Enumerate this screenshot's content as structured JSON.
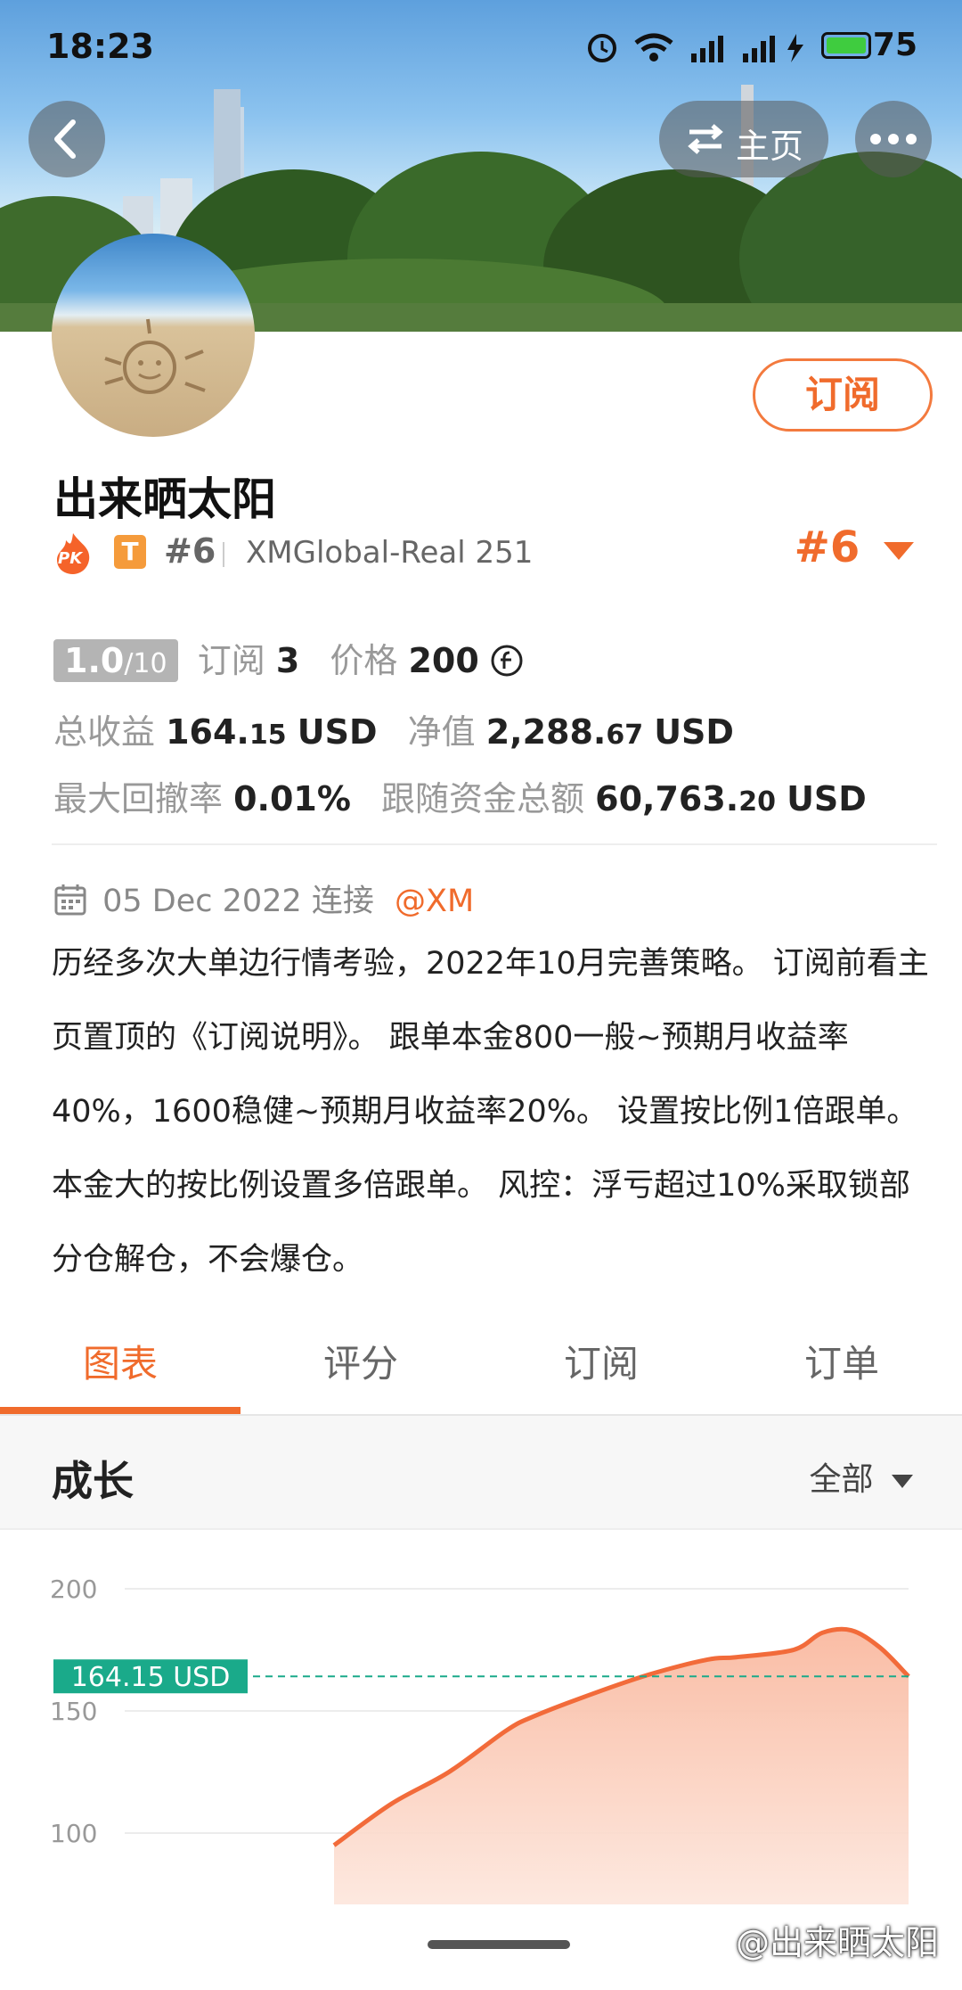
{
  "status_bar": {
    "time": "18:23",
    "battery": "75"
  },
  "header": {
    "home_label": "主页"
  },
  "profile": {
    "subscribe_label": "订阅",
    "name": "出来晒太阳",
    "pk_badge": "PK",
    "tier_badge": "T",
    "rank": "#6",
    "account": "XMGlobal-Real 251",
    "rank_dropdown": "#6"
  },
  "stats": {
    "score": "1.0",
    "score_max": "/10",
    "subscribe_label": "订阅",
    "subscribe_count": "3",
    "price_label": "价格",
    "price_value": "200",
    "total_profit_label": "总收益",
    "total_profit_int": "164.",
    "total_profit_dec": "15",
    "total_profit_unit": "USD",
    "equity_label": "净值",
    "equity_int": "2,288.",
    "equity_dec": "67",
    "equity_unit": "USD",
    "drawdown_label": "最大回撤率",
    "drawdown_value": "0.01%",
    "follow_label": "跟随资金总额",
    "follow_int": "60,763.",
    "follow_dec": "20",
    "follow_unit": "USD"
  },
  "connection": {
    "date_text": "05 Dec 2022 连接",
    "broker": "@XM"
  },
  "description": "历经多次大单边行情考验，2022年10月完善策略。 订阅前看主页置顶的《订阅说明》。 跟单本金800一般~预期月收益率40%，1600稳健~预期月收益率20%。 设置按比例1倍跟单。 本金大的按比例设置多倍跟单。 风控：浮亏超过10%采取锁部分仓解仓，不会爆仓。",
  "tabs": [
    {
      "label": "图表",
      "active": true
    },
    {
      "label": "评分",
      "active": false
    },
    {
      "label": "订阅",
      "active": false
    },
    {
      "label": "订单",
      "active": false
    }
  ],
  "section": {
    "title": "成长",
    "range": "全部"
  },
  "chart_data": {
    "type": "area",
    "title": "",
    "ylim": [
      50,
      200
    ],
    "y_ticks": [
      "200",
      "150",
      "100"
    ],
    "current_label": "164.15 USD",
    "current_value": 164.15,
    "x": [
      0.0,
      0.1,
      0.2,
      0.3,
      0.35,
      0.45,
      0.55,
      0.65,
      0.7,
      0.8,
      0.85,
      0.9,
      0.95,
      1.0
    ],
    "values": [
      95,
      112,
      125,
      142,
      148,
      157,
      165,
      171,
      172,
      175,
      182,
      183,
      176,
      164.15
    ],
    "color": "#f26b3a",
    "fill_color": "#f9b9a0"
  },
  "watermark": "@出来晒太阳",
  "colors": {
    "accent": "#f06b2c",
    "chart_line": "#f26b3a",
    "current_label_bg": "#1aaa8a"
  }
}
